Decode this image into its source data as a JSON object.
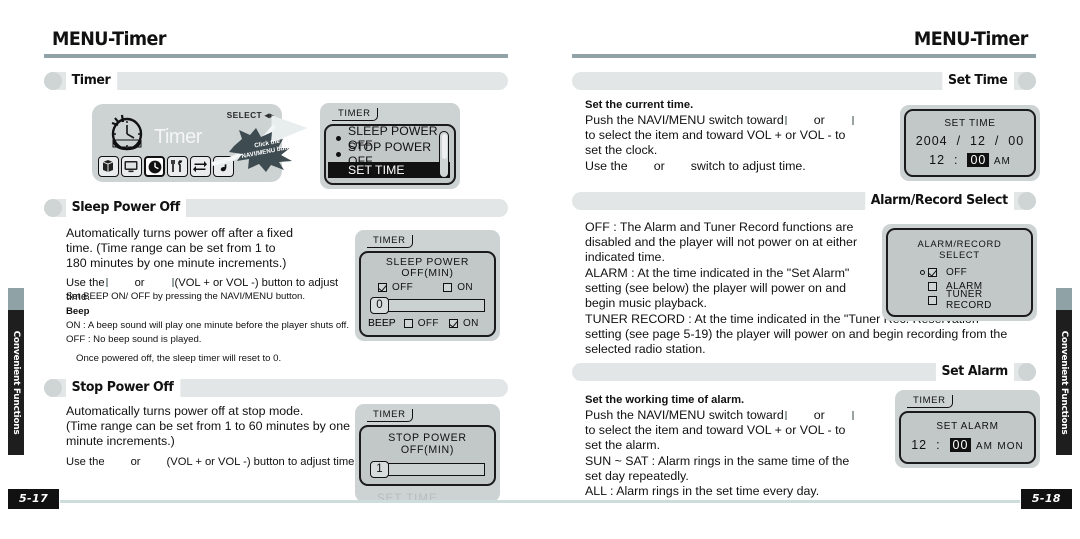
{
  "left_page": {
    "chapter_title": "MENU-Timer",
    "page_number": "5-17",
    "side_tab": "Convenient Functions",
    "sections": {
      "timer": {
        "heading": "Timer",
        "illustration": {
          "select_label": "SELECT",
          "screen_word": "Timer",
          "callout": "Click the NAVI/MENU button",
          "icons": [
            "cube-icon",
            "display-icon",
            "clock-icon",
            "tools-icon",
            "repeat-icon",
            "music-note-icon"
          ],
          "lcd": {
            "tab": "TIMER",
            "items": [
              "SLEEP POWER OFF",
              "STOP POWER OFF",
              "SET TIME"
            ],
            "selected": "SET TIME"
          }
        }
      },
      "sleep_power_off": {
        "heading": "Sleep Power Off",
        "para1": "Automatically turns power off after a fixed",
        "para2": "time. (Time range can be set from 1 to",
        "para3": "180 minutes by one minute increments.)",
        "use_prefix": "Use the",
        "use_mid": "or",
        "use_suffix": "(VOL + or VOL -) button to adjust time.",
        "beep_set": "Set  BEEP ON/ OFF by pressing the NAVI/MENU button.",
        "beep_heading": "Beep",
        "beep_on": "ON : A beep sound will play one minute before the player shuts off.",
        "beep_off": "OFF : No beep sound is played.",
        "note": "Once powered off, the sleep timer will reset to 0.",
        "lcd": {
          "tab": "TIMER",
          "title": "SLEEP POWER OFF(MIN)",
          "off_label": "OFF",
          "off_checked": true,
          "on_label": "ON",
          "on_checked": false,
          "value": "0",
          "beep_label": "BEEP",
          "beep_off_label": "OFF",
          "beep_off_checked": false,
          "beep_on_label": "ON",
          "beep_on_checked": true
        }
      },
      "stop_power_off": {
        "heading": "Stop Power Off",
        "para1": "Automatically turns power off at stop mode.",
        "para2": "(Time range can be set from 1 to 60 minutes by one",
        "para3": "minute increments.)",
        "use_prefix": "Use the",
        "use_mid": "or",
        "use_suffix": "(VOL + or VOL -) button to adjust time.",
        "lcd": {
          "tab": "TIMER",
          "title": "STOP POWER OFF(MIN)",
          "value": "1",
          "ghost": "SET TIME"
        }
      }
    }
  },
  "right_page": {
    "chapter_title": "MENU-Timer",
    "page_number": "5-18",
    "side_tab": "Convenient Functions",
    "sections": {
      "set_time": {
        "heading": "Set Time",
        "sub_heading": "Set the current time.",
        "line1_a": "Push the NAVI/MENU switch toward",
        "line1_or": "or",
        "line2": "to select the item and toward VOL + or VOL - to",
        "line3": "set the clock.",
        "line4_a": "Use the",
        "line4_or": "or",
        "line4_b": "switch to adjust time.",
        "lcd": {
          "title": "SET TIME",
          "year": "2004",
          "month": "12",
          "day": "00",
          "hour": "12",
          "minute": "00",
          "meridiem": "AM"
        }
      },
      "alarm_record_select": {
        "heading": "Alarm/Record Select",
        "para_off_1": "OFF : The Alarm and Tuner Record functions are",
        "para_off_2": "disabled and the player will not power on at either",
        "para_off_3": "indicated time.",
        "para_alarm_1": "ALARM : At the time indicated in the \"Set Alarm\"",
        "para_alarm_2": "setting (see below) the player will power on and",
        "para_alarm_3": "begin music playback.",
        "para_tuner_1": "TUNER RECORD : At the time indicated in the \"Tuner Rec. Reservation\"",
        "para_tuner_2": "setting (see page 5-19) the player will power on and begin recording from the",
        "para_tuner_3": "selected radio station.",
        "lcd": {
          "title": "ALARM/RECORD SELECT",
          "options": [
            {
              "label": "OFF",
              "checked": true,
              "cursor": true
            },
            {
              "label": "ALARM",
              "checked": false,
              "cursor": false
            },
            {
              "label": "TUNER RECORD",
              "checked": false,
              "cursor": false
            }
          ]
        }
      },
      "set_alarm": {
        "heading": "Set Alarm",
        "sub_heading": "Set the working time of alarm.",
        "line1_a": "Push the NAVI/MENU switch toward",
        "line1_or": "or",
        "line2": "to select the item and toward VOL + or VOL - to",
        "line3": "set the alarm.",
        "line4": "SUN ~ SAT : Alarm rings in the same time of the",
        "line5": "set day repeatedly.",
        "line6": "ALL : Alarm rings in the set time every day.",
        "lcd": {
          "tab": "TIMER",
          "title": "SET ALARM",
          "hour": "12",
          "minute": "00",
          "meridiem": "AM",
          "day": "MON"
        }
      }
    }
  }
}
